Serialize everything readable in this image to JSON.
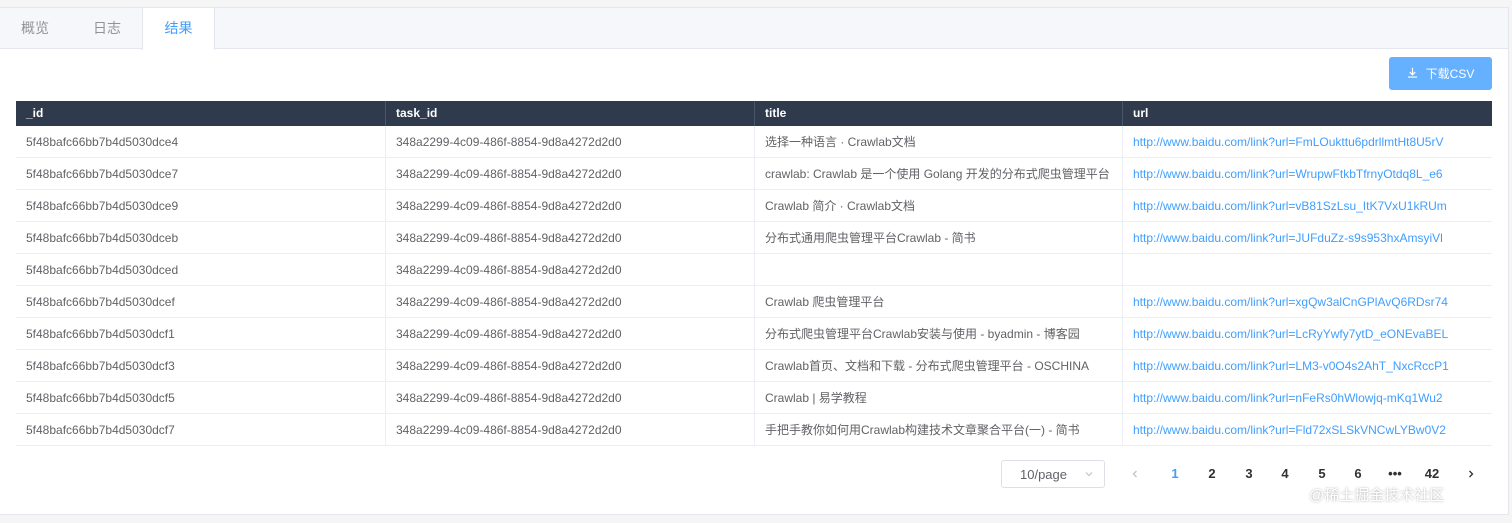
{
  "tabs": [
    "概览",
    "日志",
    "结果"
  ],
  "download_button": "下载CSV",
  "columns": [
    "_id",
    "task_id",
    "title",
    "url"
  ],
  "rows": [
    [
      "5f48bafc66bb7b4d5030dce4",
      "348a2299-4c09-486f-8854-9d8a4272d2d0",
      "选择一种语言 · Crawlab文档",
      "http://www.baidu.com/link?url=FmLOukttu6pdrllmtHt8U5rV"
    ],
    [
      "5f48bafc66bb7b4d5030dce7",
      "348a2299-4c09-486f-8854-9d8a4272d2d0",
      "crawlab: Crawlab 是一个使用 Golang 开发的分布式爬虫管理平台",
      "http://www.baidu.com/link?url=WrupwFtkbTfrnyOtdq8L_e6"
    ],
    [
      "5f48bafc66bb7b4d5030dce9",
      "348a2299-4c09-486f-8854-9d8a4272d2d0",
      "Crawlab 简介 · Crawlab文档",
      "http://www.baidu.com/link?url=vB81SzLsu_ItK7VxU1kRUm"
    ],
    [
      "5f48bafc66bb7b4d5030dceb",
      "348a2299-4c09-486f-8854-9d8a4272d2d0",
      "分布式通用爬虫管理平台Crawlab - 简书",
      "http://www.baidu.com/link?url=JUFduZz-s9s953hxAmsyiVl"
    ],
    [
      "5f48bafc66bb7b4d5030dced",
      "348a2299-4c09-486f-8854-9d8a4272d2d0",
      "",
      ""
    ],
    [
      "5f48bafc66bb7b4d5030dcef",
      "348a2299-4c09-486f-8854-9d8a4272d2d0",
      "Crawlab 爬虫管理平台",
      "http://www.baidu.com/link?url=xgQw3alCnGPlAvQ6RDsr74"
    ],
    [
      "5f48bafc66bb7b4d5030dcf1",
      "348a2299-4c09-486f-8854-9d8a4272d2d0",
      "分布式爬虫管理平台Crawlab安装与使用 - byadmin - 博客园",
      "http://www.baidu.com/link?url=LcRyYwfy7ytD_eONEvaBEL"
    ],
    [
      "5f48bafc66bb7b4d5030dcf3",
      "348a2299-4c09-486f-8854-9d8a4272d2d0",
      "Crawlab首页、文档和下载 - 分布式爬虫管理平台 - OSCHINA",
      "http://www.baidu.com/link?url=LM3-v0O4s2AhT_NxcRccP1"
    ],
    [
      "5f48bafc66bb7b4d5030dcf5",
      "348a2299-4c09-486f-8854-9d8a4272d2d0",
      "Crawlab | 易学教程",
      "http://www.baidu.com/link?url=nFeRs0hWlowjq-mKq1Wu2"
    ],
    [
      "5f48bafc66bb7b4d5030dcf7",
      "348a2299-4c09-486f-8854-9d8a4272d2d0",
      "手把手教你如何用Crawlab构建技术文章聚合平台(一) - 简书",
      "http://www.baidu.com/link?url=Fld72xSLSkVNCwLYBw0V2"
    ]
  ],
  "pagination": {
    "page_size": "10/page",
    "pages": [
      "1",
      "2",
      "3",
      "4",
      "5",
      "6",
      "•••",
      "42"
    ],
    "current": "1"
  },
  "watermark": "@稀土掘金技术社区",
  "colors": {
    "accent": "#409eff",
    "header_bg": "#2f3a4c",
    "button_bg": "#66b1ff"
  }
}
